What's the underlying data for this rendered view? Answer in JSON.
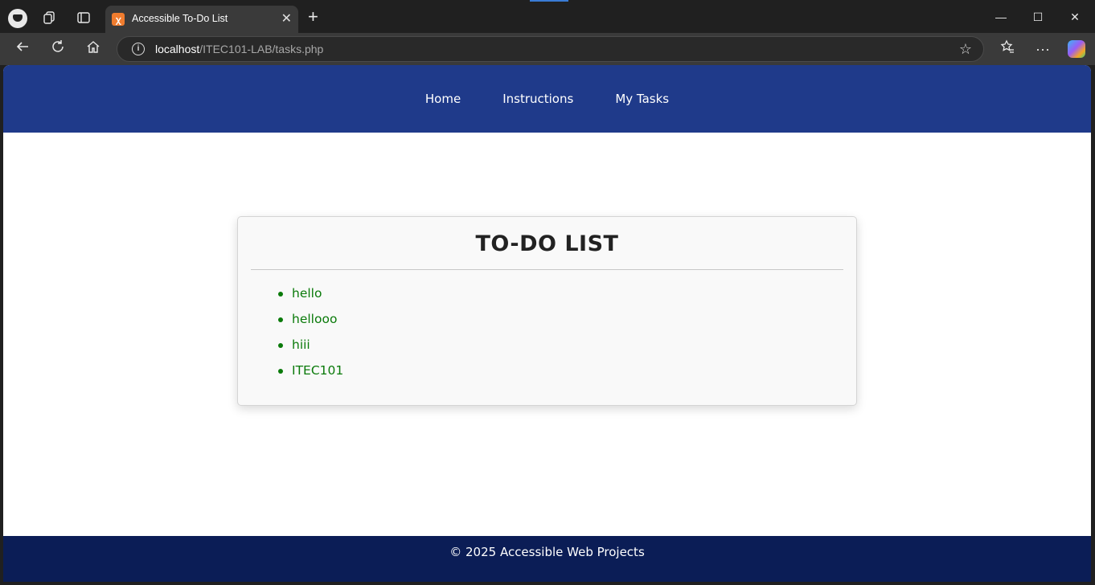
{
  "browser": {
    "tab_title": "Accessible To-Do List",
    "url_host": "localhost",
    "url_path": "/ITEC101-LAB/tasks.php",
    "new_tab_label": "+",
    "tab_close_label": "✕"
  },
  "site": {
    "nav": [
      {
        "label": "Home"
      },
      {
        "label": "Instructions"
      },
      {
        "label": "My Tasks"
      }
    ],
    "card_title": "TO-DO LIST",
    "tasks": [
      "hello",
      "hellooo",
      "hiii",
      "ITEC101"
    ],
    "footer": "© 2025 Accessible Web Projects"
  },
  "colors": {
    "header": "#1f3a8a",
    "footer": "#0b1d56",
    "task_text": "#0a7a0a"
  },
  "icons": [
    "profile-icon",
    "workspaces-icon",
    "tab-actions-icon",
    "back-icon",
    "refresh-icon",
    "home-icon",
    "info-icon",
    "favorite-star-icon",
    "favorites-icon",
    "more-icon",
    "copilot-icon"
  ]
}
